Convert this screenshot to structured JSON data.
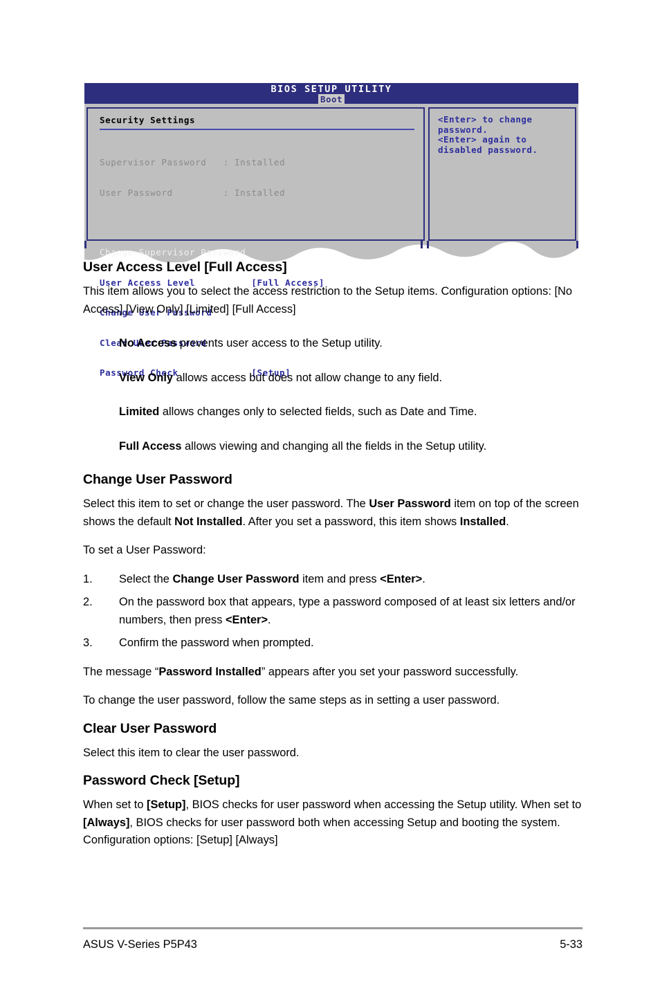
{
  "bios": {
    "title": "BIOS SETUP UTILITY",
    "active_tab": "Boot",
    "panel_heading": "Security Settings",
    "rows": [
      {
        "label": "Supervisor Password   : Installed",
        "style": "grey"
      },
      {
        "label": "User Password         : Installed",
        "style": "grey"
      },
      {
        "label": "Change Supervisor Password",
        "style": "white"
      },
      {
        "label": "User Access Level          [Full Access]",
        "style": "blue"
      },
      {
        "label": "Change User Password",
        "style": "blue"
      },
      {
        "label": "Clear User Password",
        "style": "blue"
      },
      {
        "label": "Password Check             [Setup]",
        "style": "blue"
      }
    ],
    "help_text": "<Enter> to change\npassword.\n<Enter> again to\ndisabled password.",
    "colors": {
      "titlebar": "#2e2e7e",
      "panel_bg": "#bfbfbf",
      "border": "#2e2e7e",
      "blue_text": "#2e2e9e",
      "grey_text": "#8a8a8a",
      "tab_bg": "#c9c9c9"
    }
  },
  "doc": {
    "section_user_access_level": {
      "heading": "User Access Level [Full Access]",
      "paragraph_line1": "This item allows you to select the access restriction to the Setup items.",
      "paragraph_line2": "Configuration options: [No Access] [View Only] [Limited] [Full Access]",
      "definitions": [
        {
          "term": "No Access",
          "text": " prevents user access to the Setup utility."
        },
        {
          "term": "View Only",
          "text": " allows access but does not allow change to any field."
        },
        {
          "term": "Limited",
          "text": " allows changes only to selected fields, such as Date and Time."
        },
        {
          "term": "Full Access",
          "text": " allows viewing and changing all the fields in the Setup utility."
        }
      ]
    },
    "section_change_user_password": {
      "heading": "Change User Password",
      "p1_a": "Select this item to set or change the user password. The ",
      "p1_b": "User Password",
      "p1_c": " item on top of the screen shows the default ",
      "p1_d": "Not Installed",
      "p1_e": ". After you set a password, this item shows ",
      "p1_f": "Installed",
      "p1_g": ".",
      "p2": "To set a User Password:",
      "steps": [
        {
          "num": "1.",
          "a": "Select the ",
          "b": "Change User Password",
          "c": " item and press ",
          "d": "<Enter>",
          "e": "."
        },
        {
          "num": "2.",
          "a": "On the password box that appears, type a password composed of at least six letters and/or numbers, then press ",
          "b": "",
          "c": "",
          "d": "<Enter>",
          "e": "."
        },
        {
          "num": "3.",
          "a": "Confirm the password when prompted.",
          "b": "",
          "c": "",
          "d": "",
          "e": ""
        }
      ],
      "p3_a": "The message “",
      "p3_b": "Password Installed",
      "p3_c": "” appears after you set your password successfully.",
      "p4": "To change the user password, follow the same steps as in setting a user password."
    },
    "section_clear_user_password": {
      "heading": "Clear User Password",
      "paragraph": "Select this item to clear the user password."
    },
    "section_password_check": {
      "heading": "Password Check [Setup]",
      "p_a": "When set to ",
      "p_b": "[Setup]",
      "p_c": ", BIOS checks for user password when accessing the Setup utility. When set to ",
      "p_d": "[Always]",
      "p_e": ", BIOS checks for user password both when accessing Setup and booting the system. Configuration options: [Setup] [Always]"
    }
  },
  "footer": {
    "left": "ASUS V-Series P5P43",
    "page": "5-33"
  }
}
